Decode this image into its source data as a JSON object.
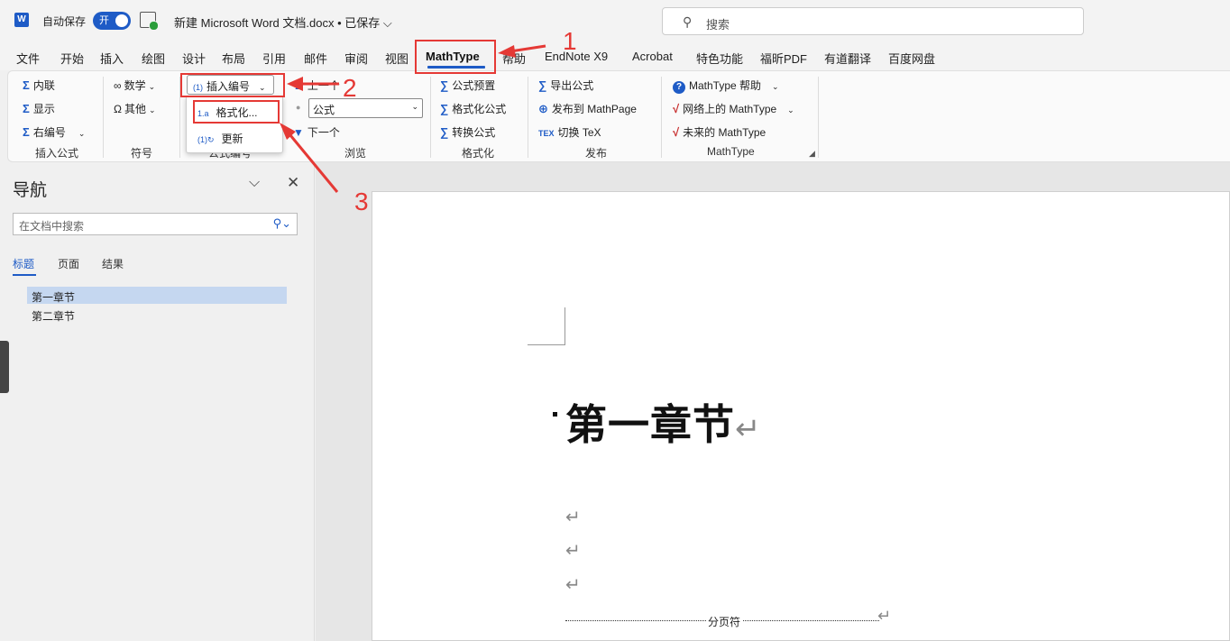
{
  "titlebar": {
    "logo": "W",
    "autosave_label": "自动保存",
    "autosave_state": "开",
    "doc_title": "新建 Microsoft Word 文档.docx • 已保存 ⌵",
    "search_placeholder": "搜索"
  },
  "tabs": [
    {
      "label": "文件"
    },
    {
      "label": "开始"
    },
    {
      "label": "插入"
    },
    {
      "label": "绘图"
    },
    {
      "label": "设计"
    },
    {
      "label": "布局"
    },
    {
      "label": "引用"
    },
    {
      "label": "邮件"
    },
    {
      "label": "审阅"
    },
    {
      "label": "视图"
    },
    {
      "label": "MathType"
    },
    {
      "label": "帮助"
    },
    {
      "label": "EndNote X9"
    },
    {
      "label": "Acrobat"
    },
    {
      "label": "特色功能"
    },
    {
      "label": "福昕PDF"
    },
    {
      "label": "有道翻译"
    },
    {
      "label": "百度网盘"
    }
  ],
  "ribbon": {
    "insert_formula": {
      "inline": "内联",
      "display": "显示",
      "right_numbered": "右编号",
      "group": "插入公式"
    },
    "symbols": {
      "math": "数学",
      "other": "其他",
      "group": "符号"
    },
    "numbering": {
      "insert_number": "插入编号",
      "group": "公式编号"
    },
    "browse": {
      "prev": "上一个",
      "select_value": "公式",
      "next": "下一个",
      "group": "浏览"
    },
    "format": {
      "preset": "公式预置",
      "format_eq": "格式化公式",
      "convert": "转换公式",
      "group": "格式化"
    },
    "publish": {
      "export": "导出公式",
      "publish_mathpage": "发布到 MathPage",
      "toggle_tex": "切换 TeX",
      "group": "发布"
    },
    "mathtype": {
      "help": "MathType 帮助",
      "online": "网络上的 MathType",
      "future": "未来的 MathType",
      "group": "MathType"
    }
  },
  "dropdown": {
    "format": "格式化...",
    "update": "更新"
  },
  "annotations": {
    "n1": "1",
    "n2": "2",
    "n3": "3"
  },
  "nav": {
    "title": "导航",
    "search_placeholder": "在文档中搜索",
    "tabs": [
      {
        "label": "标题"
      },
      {
        "label": "页面"
      },
      {
        "label": "结果"
      }
    ],
    "headings": [
      {
        "label": "第一章节"
      },
      {
        "label": "第二章节"
      }
    ]
  },
  "document": {
    "heading": "第一章节",
    "para_mark": "↵",
    "page_break": "分页符"
  }
}
